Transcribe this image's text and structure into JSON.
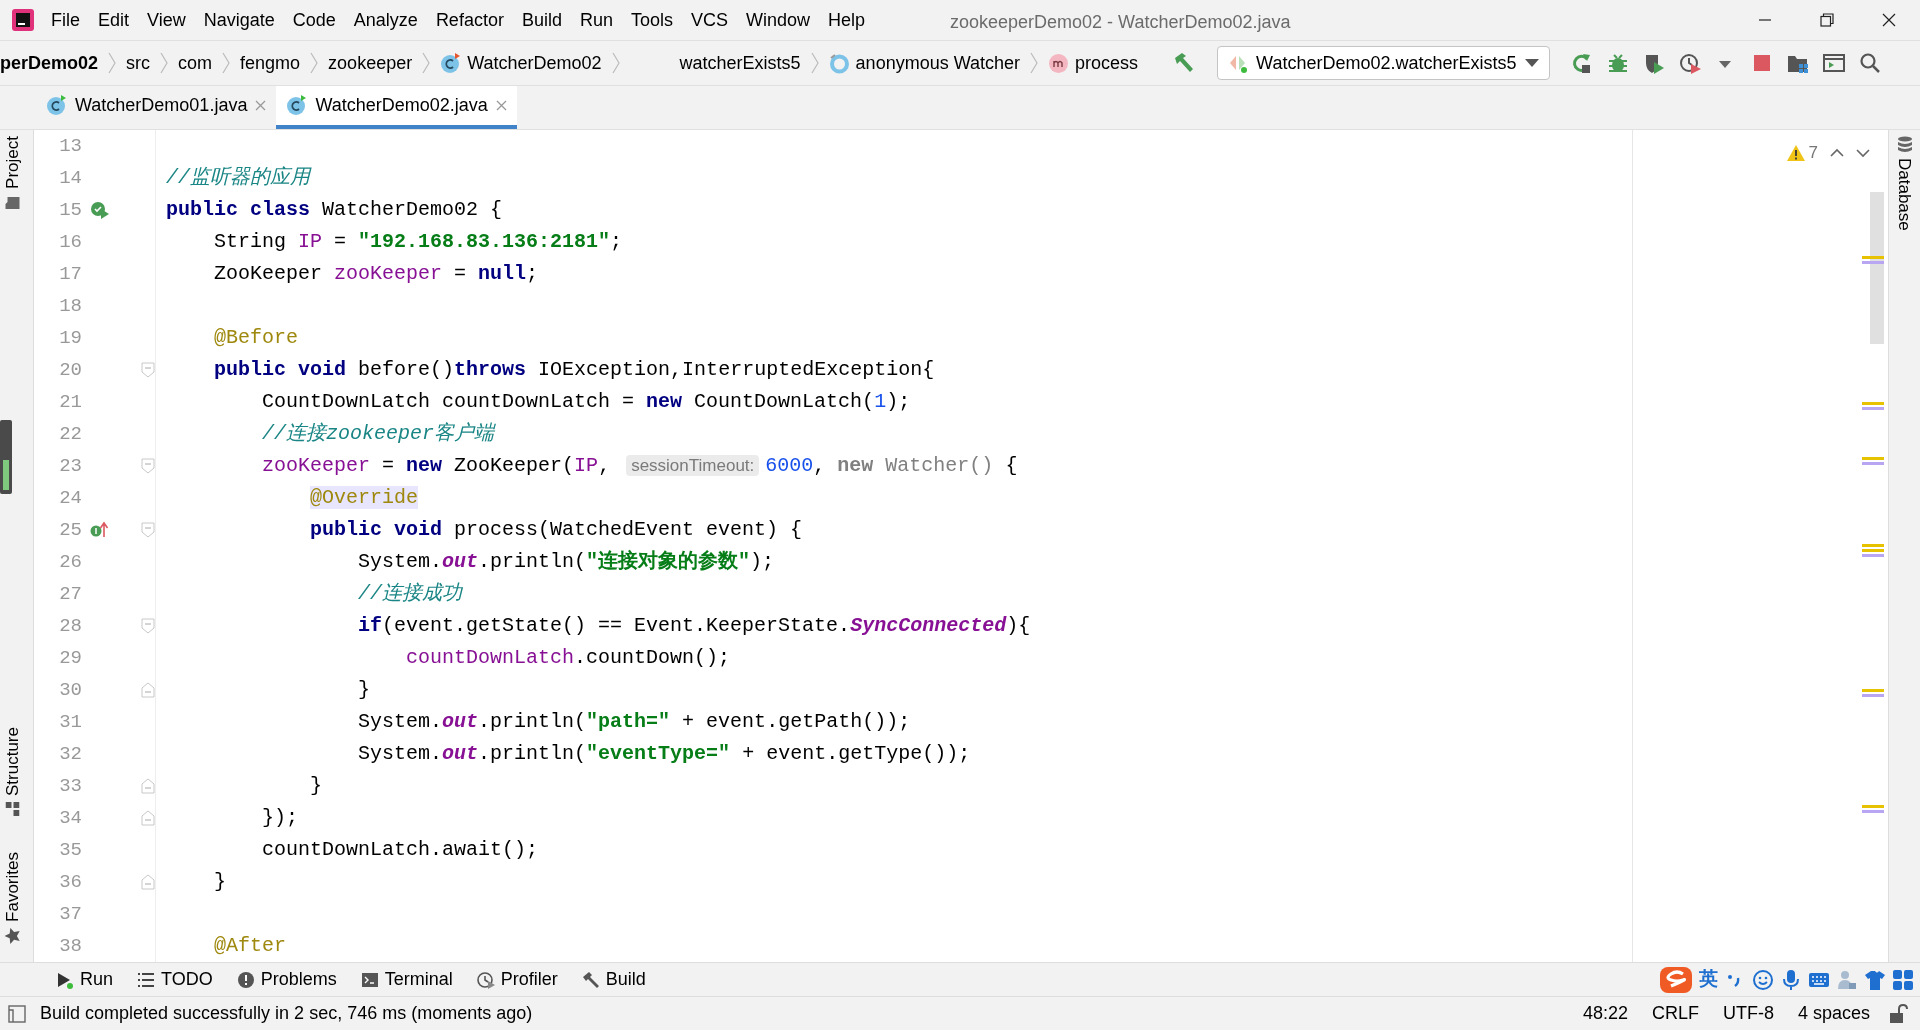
{
  "window": {
    "title": "zookeeperDemo02 - WatcherDemo02.java"
  },
  "menu": [
    "File",
    "Edit",
    "View",
    "Navigate",
    "Code",
    "Analyze",
    "Refactor",
    "Build",
    "Run",
    "Tools",
    "VCS",
    "Window",
    "Help"
  ],
  "breadcrumbs": [
    {
      "label": "perDemo02",
      "kind": "project"
    },
    {
      "label": "src",
      "kind": "folder"
    },
    {
      "label": "com",
      "kind": "folder"
    },
    {
      "label": "fengmo",
      "kind": "folder"
    },
    {
      "label": "zookeeper",
      "kind": "folder"
    },
    {
      "label": "WatcherDemo02",
      "kind": "class"
    },
    {
      "label": "watcherExists5",
      "kind": "member"
    },
    {
      "label": "anonymous Watcher",
      "kind": "anonymous"
    },
    {
      "label": "process",
      "kind": "method"
    }
  ],
  "run_config": {
    "label": "WatcherDemo02.watcherExists5"
  },
  "tabs": [
    {
      "label": "WatcherDemo01.java",
      "selected": false
    },
    {
      "label": "WatcherDemo02.java",
      "selected": true
    }
  ],
  "left_tool_windows_top": [
    "Project"
  ],
  "left_tool_windows_bottom": [
    "Structure",
    "Favorites"
  ],
  "right_tool_windows": [
    "Database"
  ],
  "inspections": {
    "warnings": "7"
  },
  "code_lines": [
    {
      "number": "13"
    },
    {
      "number": "14",
      "tokens": [
        {
          "kind": "com",
          "t": "//监听器的应用"
        }
      ]
    },
    {
      "number": "15",
      "gutter_icon": {
        "kind": "run"
      },
      "tokens": [
        {
          "kind": "kw",
          "t": "public "
        },
        {
          "kind": "kw",
          "t": "class"
        },
        {
          "kind": "txt",
          "t": " WatcherDemo02 {"
        }
      ]
    },
    {
      "number": "16",
      "tokens": [
        {
          "kind": "txt",
          "t": "    String "
        },
        {
          "kind": "field",
          "t": "IP"
        },
        {
          "kind": "txt",
          "t": " = "
        },
        {
          "kind": "str",
          "t": "\"192.168.83.136:2181\""
        },
        {
          "kind": "txt",
          "t": ";"
        }
      ]
    },
    {
      "number": "17",
      "tokens": [
        {
          "kind": "txt",
          "t": "    ZooKeeper "
        },
        {
          "kind": "field",
          "t": "zooKeeper"
        },
        {
          "kind": "txt",
          "t": " = "
        },
        {
          "kind": "kw",
          "t": "null"
        },
        {
          "kind": "txt",
          "t": ";"
        }
      ]
    },
    {
      "number": "18"
    },
    {
      "number": "19",
      "tokens": [
        {
          "kind": "ann",
          "t": "    @Before"
        }
      ]
    },
    {
      "number": "20",
      "fold": {
        "kind": "start"
      },
      "tokens": [
        {
          "kind": "kw",
          "t": "    public "
        },
        {
          "kind": "kw",
          "t": "void"
        },
        {
          "kind": "txt",
          "t": " before()"
        },
        {
          "kind": "kw",
          "t": "throws"
        },
        {
          "kind": "txt",
          "t": " IOException,InterruptedException{"
        }
      ]
    },
    {
      "number": "21",
      "tokens": [
        {
          "kind": "txt",
          "t": "        CountDownLatch countDownLatch = "
        },
        {
          "kind": "kw",
          "t": "new"
        },
        {
          "kind": "txt",
          "t": " CountDownLatch("
        },
        {
          "kind": "num",
          "t": "1"
        },
        {
          "kind": "txt",
          "t": ");"
        }
      ]
    },
    {
      "number": "22",
      "tokens": [
        {
          "kind": "com",
          "t": "        //连接zookeeper客户端"
        }
      ]
    },
    {
      "number": "23",
      "fold": {
        "kind": "start"
      },
      "tokens": [
        {
          "kind": "field",
          "t": "        zooKeeper"
        },
        {
          "kind": "txt",
          "t": " = "
        },
        {
          "kind": "kw",
          "t": "new"
        },
        {
          "kind": "txt",
          "t": " ZooKeeper("
        },
        {
          "kind": "field",
          "t": "IP"
        },
        {
          "kind": "txt",
          "t": ", "
        },
        {
          "kind": "hint",
          "t": "sessionTimeout:"
        },
        {
          "kind": "num",
          "t": "6000"
        },
        {
          "kind": "txt",
          "t": ", "
        },
        {
          "kind": "dimkw",
          "t": "new"
        },
        {
          "kind": "dim",
          "t": " Watcher()"
        },
        {
          "kind": "txt",
          "t": " {"
        }
      ]
    },
    {
      "number": "24",
      "tokens": [
        {
          "kind": "ann",
          "t": "            @Override",
          "highlighted": true
        }
      ]
    },
    {
      "number": "25",
      "gutter_icon": {
        "kind": "implement"
      },
      "fold": {
        "kind": "start"
      },
      "tokens": [
        {
          "kind": "kw",
          "t": "            public "
        },
        {
          "kind": "kw",
          "t": "void"
        },
        {
          "kind": "txt",
          "t": " process(WatchedEvent event) {"
        }
      ]
    },
    {
      "number": "26",
      "tokens": [
        {
          "kind": "txt",
          "t": "                System."
        },
        {
          "kind": "static",
          "t": "out"
        },
        {
          "kind": "txt",
          "t": ".println("
        },
        {
          "kind": "str",
          "t": "\"连接对象的参数\""
        },
        {
          "kind": "txt",
          "t": ");"
        }
      ]
    },
    {
      "number": "27",
      "tokens": [
        {
          "kind": "com",
          "t": "                //连接成功"
        }
      ]
    },
    {
      "number": "28",
      "fold": {
        "kind": "start"
      },
      "tokens": [
        {
          "kind": "kw",
          "t": "                if"
        },
        {
          "kind": "txt",
          "t": "(event.getState() == Event.KeeperState."
        },
        {
          "kind": "static",
          "t": "SyncConnected"
        },
        {
          "kind": "txt",
          "t": "){"
        }
      ]
    },
    {
      "number": "29",
      "tokens": [
        {
          "kind": "field",
          "t": "                    countDownLatch"
        },
        {
          "kind": "txt",
          "t": ".countDown();"
        }
      ]
    },
    {
      "number": "30",
      "fold": {
        "kind": "end"
      },
      "tokens": [
        {
          "kind": "txt",
          "t": "                }"
        }
      ]
    },
    {
      "number": "31",
      "tokens": [
        {
          "kind": "txt",
          "t": "                System."
        },
        {
          "kind": "static",
          "t": "out"
        },
        {
          "kind": "txt",
          "t": ".println("
        },
        {
          "kind": "str",
          "t": "\"path=\""
        },
        {
          "kind": "txt",
          "t": " + event.getPath());"
        }
      ]
    },
    {
      "number": "32",
      "tokens": [
        {
          "kind": "txt",
          "t": "                System."
        },
        {
          "kind": "static",
          "t": "out"
        },
        {
          "kind": "txt",
          "t": ".println("
        },
        {
          "kind": "str",
          "t": "\"eventType=\""
        },
        {
          "kind": "txt",
          "t": " + event.getType());"
        }
      ]
    },
    {
      "number": "33",
      "fold": {
        "kind": "end"
      },
      "tokens": [
        {
          "kind": "txt",
          "t": "            }"
        }
      ]
    },
    {
      "number": "34",
      "fold": {
        "kind": "end"
      },
      "tokens": [
        {
          "kind": "txt",
          "t": "        });"
        }
      ]
    },
    {
      "number": "35",
      "tokens": [
        {
          "kind": "txt",
          "t": "        countDownLatch.await();"
        }
      ]
    },
    {
      "number": "36",
      "fold": {
        "kind": "end"
      },
      "tokens": [
        {
          "kind": "txt",
          "t": "    }"
        }
      ]
    },
    {
      "number": "37"
    },
    {
      "number": "38",
      "tokens": [
        {
          "kind": "ann",
          "t": "    @After"
        }
      ]
    }
  ],
  "tool_buttons": [
    {
      "label": "Run",
      "kind": "run"
    },
    {
      "label": "TODO",
      "kind": "todo"
    },
    {
      "label": "Problems",
      "kind": "problems"
    },
    {
      "label": "Terminal",
      "kind": "terminal"
    },
    {
      "label": "Profiler",
      "kind": "profiler"
    },
    {
      "label": "Build",
      "kind": "build"
    }
  ],
  "ime": {
    "mode": "英"
  },
  "status_bar": {
    "message": "Build completed successfully in 2 sec, 746 ms (moments ago)",
    "items": [
      "48:22",
      "CRLF",
      "UTF-8",
      "4 spaces"
    ]
  }
}
